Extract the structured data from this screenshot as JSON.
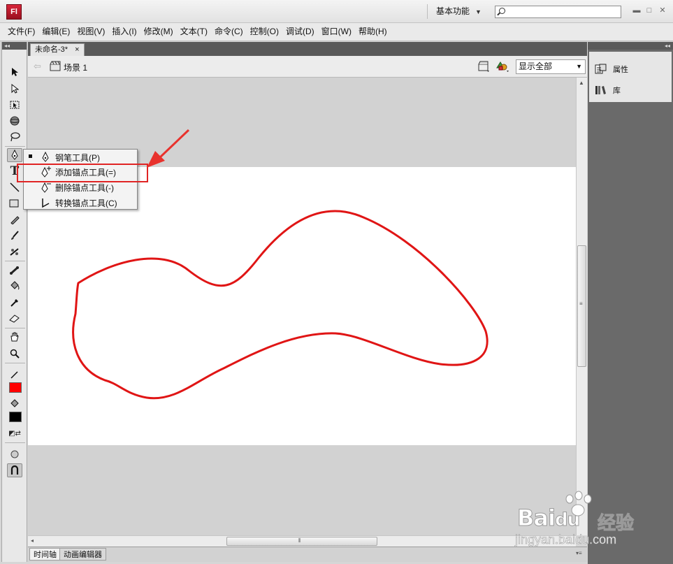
{
  "app": {
    "logo_text": "Fl",
    "workspace_label": "基本功能",
    "search_placeholder": ""
  },
  "menu": [
    "文件(F)",
    "编辑(E)",
    "视图(V)",
    "插入(I)",
    "修改(M)",
    "文本(T)",
    "命令(C)",
    "控制(O)",
    "调试(D)",
    "窗口(W)",
    "帮助(H)"
  ],
  "document": {
    "tab_title": "未命名-3*",
    "close_glyph": "×",
    "scene_label": "场景 1",
    "zoom_value": "显示全部"
  },
  "tools_submenu": {
    "items": [
      {
        "label": "钢笔工具(P)",
        "selected": true,
        "icon": "pen-icon"
      },
      {
        "label": "添加锚点工具(=)",
        "selected": false,
        "icon": "add-anchor-pen-icon"
      },
      {
        "label": "删除锚点工具(-)",
        "selected": false,
        "icon": "delete-anchor-pen-icon"
      },
      {
        "label": "转换锚点工具(C)",
        "selected": false,
        "icon": "convert-anchor-icon"
      }
    ]
  },
  "toolbar": {
    "stroke_color": "#ff0000",
    "fill_color": "#000000",
    "text_tool_glyph": "T"
  },
  "right_panel": {
    "properties_label": "属性",
    "library_label": "库"
  },
  "bottom_tabs": [
    "时间轴",
    "动画编辑器"
  ],
  "canvas": {
    "stroke_color": "#e01515"
  },
  "watermark": {
    "brand": "Bai",
    "brand_du": "du",
    "suffix": "经验",
    "url": "jingyan.baidu.com"
  }
}
